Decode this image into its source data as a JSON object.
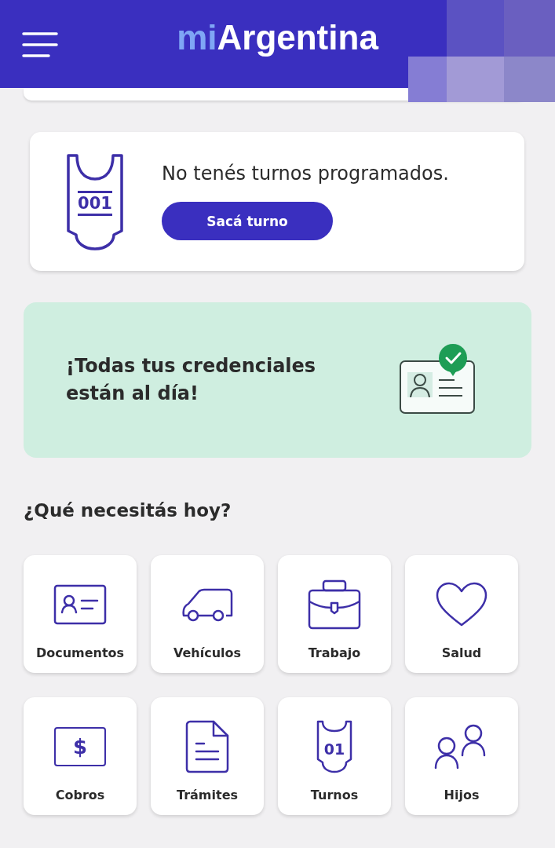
{
  "header": {
    "logo": [
      "mi",
      "Argentina"
    ]
  },
  "appointments": {
    "ticket_number": "001",
    "message": "No tenés turnos programados.",
    "button": "Sacá turno"
  },
  "credentials_banner": {
    "message": "¡Todas tus credenciales están al día!"
  },
  "section_title": "¿Qué necesitás hoy?",
  "tiles": [
    {
      "kind": "id-card",
      "label": "Documentos"
    },
    {
      "kind": "car",
      "label": "Vehículos"
    },
    {
      "kind": "briefcase",
      "label": "Trabajo"
    },
    {
      "kind": "heart",
      "label": "Salud"
    },
    {
      "kind": "money",
      "label": "Cobros",
      "icon_text": "$"
    },
    {
      "kind": "document",
      "label": "Trámites"
    },
    {
      "kind": "ticket",
      "label": "Turnos",
      "icon_text": "01"
    },
    {
      "kind": "people",
      "label": "Hijos"
    }
  ]
}
